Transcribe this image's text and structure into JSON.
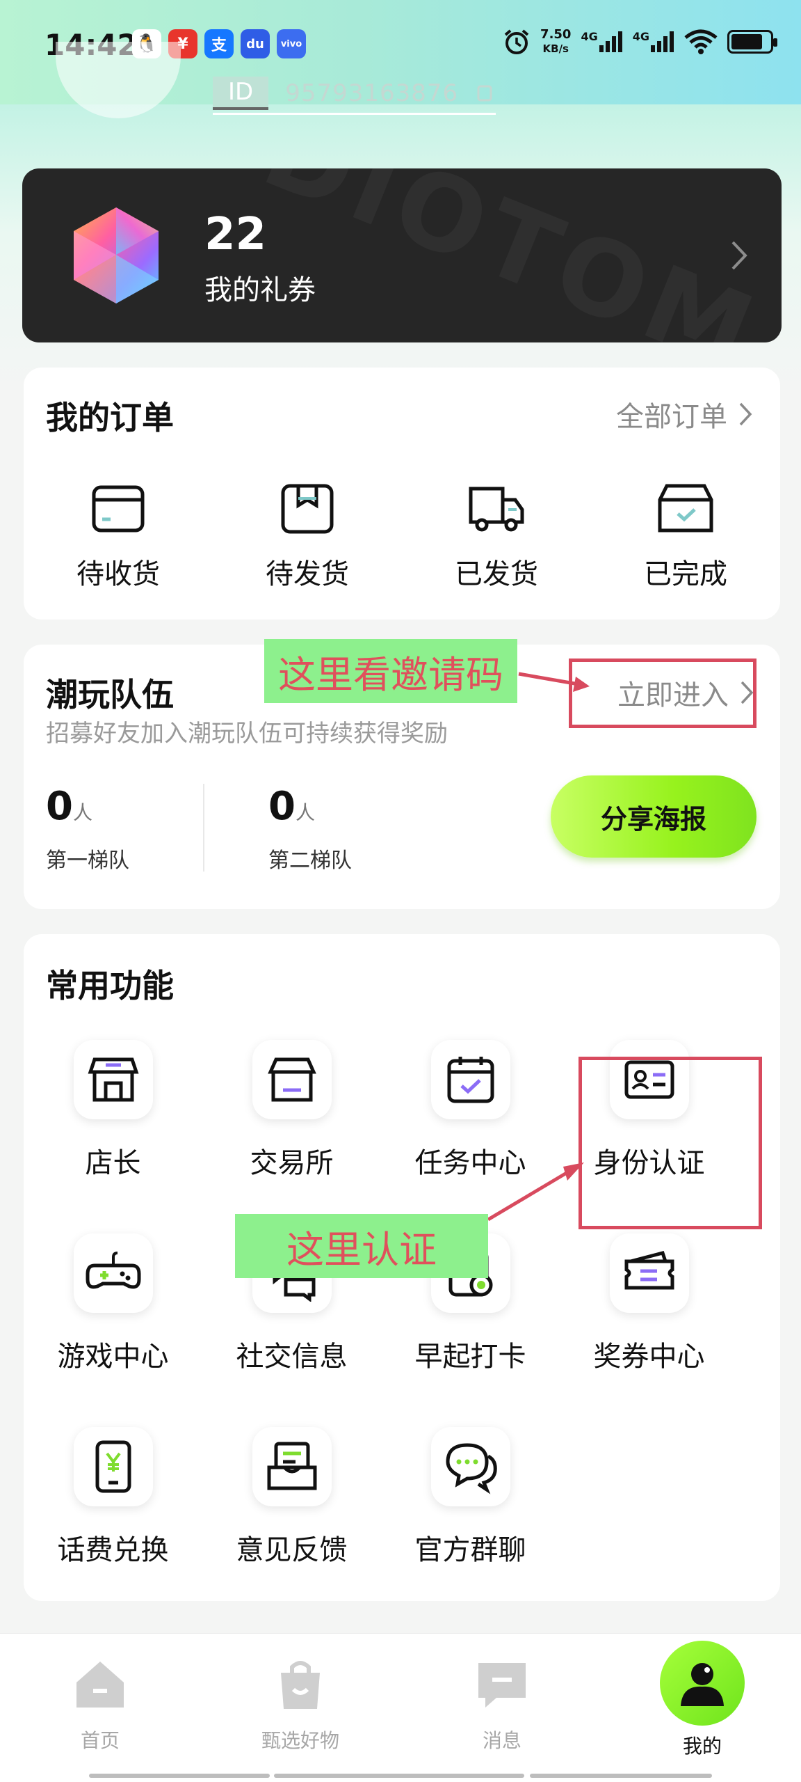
{
  "status_bar": {
    "time": "14:42",
    "apps": [
      {
        "icon": "qq-icon",
        "glyph": "🐧",
        "color": "#ffffff"
      },
      {
        "icon": "app-red-icon",
        "glyph": "¥",
        "color": "#e8352c"
      },
      {
        "icon": "alipay-icon",
        "glyph": "支",
        "color": "#1677ff"
      },
      {
        "icon": "baidu-icon",
        "glyph": "du",
        "color": "#2f5de6"
      },
      {
        "icon": "vivo-icon",
        "glyph": "vivo",
        "color": "#3c6df0"
      }
    ],
    "speed_value": "7.50",
    "speed_unit": "KB/s",
    "net1": "4G",
    "net2": "4G"
  },
  "profile": {
    "id_label": "ID",
    "id_value": "95793163876"
  },
  "voucher": {
    "count": "22",
    "label": "我的礼券"
  },
  "orders": {
    "title": "我的订单",
    "all_label": "全部订单",
    "items": [
      {
        "label": "待收货",
        "icon": "pending-receipt-icon"
      },
      {
        "label": "待发货",
        "icon": "pending-shipment-icon"
      },
      {
        "label": "已发货",
        "icon": "shipped-truck-icon"
      },
      {
        "label": "已完成",
        "icon": "completed-box-icon"
      }
    ]
  },
  "team": {
    "title": "潮玩队伍",
    "subtitle": "招募好友加入潮玩队伍可持续获得奖励",
    "enter_label": "立即进入",
    "tier1_count": "0",
    "tier1_unit": "人",
    "tier1_label": "第一梯队",
    "tier2_count": "0",
    "tier2_unit": "人",
    "tier2_label": "第二梯队",
    "share_label": "分享海报"
  },
  "functions": {
    "title": "常用功能",
    "items": [
      {
        "label": "店长",
        "icon": "store-manager-icon"
      },
      {
        "label": "交易所",
        "icon": "exchange-store-icon"
      },
      {
        "label": "任务中心",
        "icon": "task-calendar-icon"
      },
      {
        "label": "身份认证",
        "icon": "id-card-icon"
      },
      {
        "label": "游戏中心",
        "icon": "gamepad-icon"
      },
      {
        "label": "社交信息",
        "icon": "chat-bubbles-icon"
      },
      {
        "label": "早起打卡",
        "icon": "morning-checkin-icon"
      },
      {
        "label": "奖券中心",
        "icon": "ticket-icon"
      },
      {
        "label": "话费兑换",
        "icon": "phone-recharge-icon"
      },
      {
        "label": "意见反馈",
        "icon": "feedback-icon"
      },
      {
        "label": "官方群聊",
        "icon": "group-chat-icon"
      }
    ]
  },
  "annotations": {
    "invite_hint": "这里看邀请码",
    "verify_hint": "这里认证",
    "color": "#d84a5e"
  },
  "bottom_nav": {
    "items": [
      {
        "label": "首页",
        "icon": "home-icon"
      },
      {
        "label": "甄选好物",
        "icon": "shopping-bag-icon"
      },
      {
        "label": "消息",
        "icon": "message-icon"
      },
      {
        "label": "我的",
        "icon": "profile-icon"
      }
    ]
  },
  "colors": {
    "accent_green": "#97f21d",
    "voucher_bg": "#262626",
    "purple_accent": "#8b6cf6"
  }
}
